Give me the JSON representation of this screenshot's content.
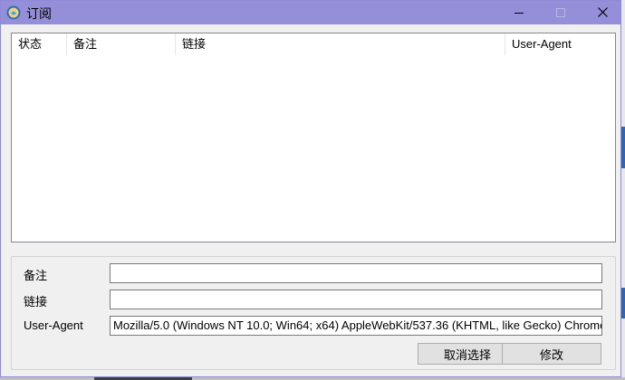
{
  "window": {
    "title": "订阅",
    "minimize_icon": "minimize-icon",
    "maximize_icon": "maximize-icon",
    "close_icon": "close-icon"
  },
  "table": {
    "columns": [
      "状态",
      "备注",
      "链接",
      "User-Agent"
    ],
    "rows": []
  },
  "form": {
    "remark_label": "备注",
    "remark_value": "",
    "link_label": "链接",
    "link_value": "",
    "ua_label": "User-Agent",
    "ua_value": "Mozilla/5.0 (Windows NT 10.0; Win64; x64) AppleWebKit/537.36 (KHTML, like Gecko) Chrome"
  },
  "buttons": {
    "deselect": "取消选择",
    "modify": "修改"
  },
  "colors": {
    "titlebar": "#958fd9",
    "window_bg": "#f0f0f0"
  }
}
